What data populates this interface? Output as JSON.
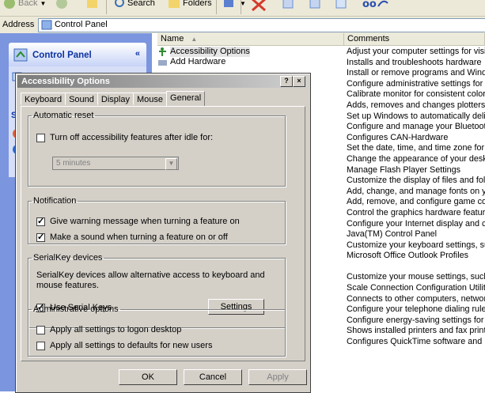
{
  "toolbar": {
    "back_label": "Back",
    "search_label": "Search",
    "folders_label": "Folders"
  },
  "address": {
    "label": "Address",
    "value": "Control Panel"
  },
  "left_pane": {
    "title": "Control Panel",
    "see_also_label": "See"
  },
  "columns": {
    "name": "Name",
    "comments": "Comments"
  },
  "items": [
    {
      "name": "Accessibility Options",
      "icon": "accessibility-icon"
    },
    {
      "name": "Add Hardware",
      "icon": "hardware-icon"
    }
  ],
  "comments": [
    "Adjust your computer settings for vision",
    "Installs and troubleshoots hardware",
    "Install or remove programs and Windows",
    "Configure administrative settings for yo",
    "Calibrate monitor for consistent color, c",
    "Adds, removes and changes plotters pr",
    "Set up Windows to automatically delive",
    "Configure and manage your Bluetooth d",
    "Configures CAN-Hardware",
    "Set the date, time, and time zone for y",
    "Change the appearance of your deskto",
    "Manage Flash Player Settings",
    "Customize the display of files and folde",
    "Add, change, and manage fonts on you",
    "Add, remove, and configure game cont",
    "Control the graphics hardware features",
    "Configure your Internet display and con",
    "Java(TM) Control Panel",
    "Customize your keyboard settings, such",
    "Microsoft Office Outlook Profiles",
    "",
    "Customize your mouse settings, such a",
    "Scale Connection Configuration Utility",
    "Connects to other computers, networks",
    "Configure your telephone dialing rules a",
    "Configure energy-saving settings for yo",
    "Shows installed printers and fax printer",
    "Configures QuickTime software and har"
  ],
  "dialog": {
    "title": "Accessibility Options",
    "help_button": "?",
    "close_button": "×",
    "tabs": [
      "Keyboard",
      "Sound",
      "Display",
      "Mouse",
      "General"
    ],
    "active_tab": "General",
    "auto_reset": {
      "legend": "Automatic reset",
      "checkbox_label": "Turn off accessibility features after idle for:",
      "checked": false,
      "dropdown_value": "5 minutes"
    },
    "notification": {
      "legend": "Notification",
      "warning_label": "Give warning message when turning a feature on",
      "warning_checked": true,
      "sound_label": "Make a sound when turning a feature on or off",
      "sound_checked": true
    },
    "serialkey": {
      "legend": "SerialKey devices",
      "description": "SerialKey devices allow alternative access to keyboard and mouse features.",
      "use_label": "Use Serial Keys",
      "use_checked": true,
      "settings_button": "Settings"
    },
    "admin": {
      "legend": "Administrative options",
      "logon_label": "Apply all settings to logon desktop",
      "logon_checked": false,
      "defaults_label": "Apply all settings to defaults for new users",
      "defaults_checked": false
    },
    "buttons": {
      "ok": "OK",
      "cancel": "Cancel",
      "apply": "Apply"
    }
  },
  "colors": {
    "left_pane": "#7b96df",
    "dialog_face": "#d4d0c8",
    "accent_blue": "#0c32a0"
  }
}
